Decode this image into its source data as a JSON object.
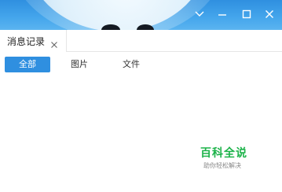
{
  "header": {
    "icons": [
      "chevron-down-icon",
      "minimize-icon",
      "maximize-icon",
      "close-icon"
    ],
    "colors": {
      "background": "#3a9be6",
      "icon": "#ffffff"
    }
  },
  "tabs": [
    {
      "label": "消息记录",
      "closable": true
    }
  ],
  "filters": [
    {
      "label": "全部",
      "active": true
    },
    {
      "label": "图片",
      "active": false
    },
    {
      "label": "文件",
      "active": false
    }
  ],
  "accent_color": "#2f8fe0",
  "watermark": {
    "title": "百科全说",
    "subtitle": "助你轻松解决",
    "color": "#1db34a"
  }
}
